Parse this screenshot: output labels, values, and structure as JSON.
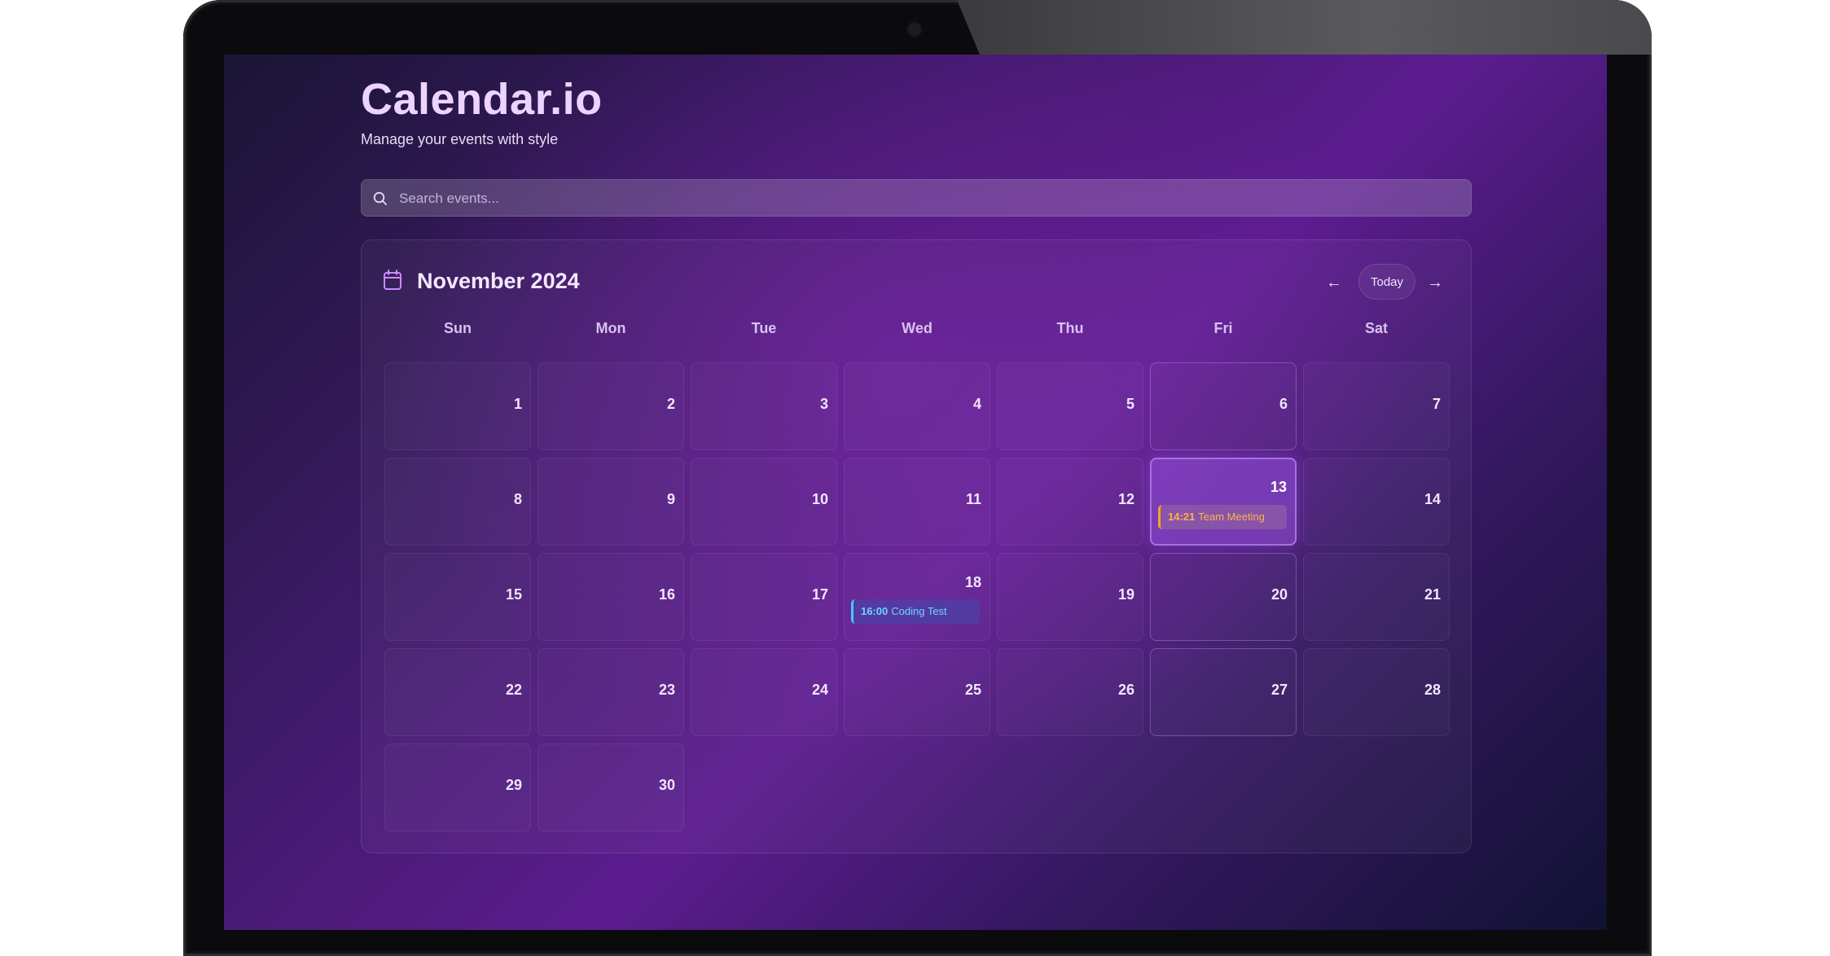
{
  "app": {
    "title": "Calendar.io",
    "subtitle": "Manage your events with style"
  },
  "search": {
    "placeholder": "Search events..."
  },
  "calendar": {
    "month_label": "November 2024",
    "prev_label": "←",
    "today_label": "Today",
    "next_label": "→",
    "weekdays": [
      "Sun",
      "Mon",
      "Tue",
      "Wed",
      "Thu",
      "Fri",
      "Sat"
    ],
    "days": [
      "1",
      "2",
      "3",
      "4",
      "5",
      "6",
      "7",
      "8",
      "9",
      "10",
      "11",
      "12",
      "13",
      "14",
      "15",
      "16",
      "17",
      "18",
      "19",
      "20",
      "21",
      "22",
      "23",
      "24",
      "25",
      "26",
      "27",
      "28",
      "29",
      "30"
    ],
    "today": "13",
    "events": [
      {
        "day": "13",
        "time": "14:21",
        "title": "Team Meeting",
        "color": "#f5a623"
      },
      {
        "day": "18",
        "time": "16:00",
        "title": "Coding Test",
        "color": "#4fc3f7"
      }
    ]
  },
  "colors": {
    "accent": "#a670e6",
    "title": "#ecd4ff",
    "event_orange": "#f5a623",
    "event_blue": "#4fc3f7"
  }
}
